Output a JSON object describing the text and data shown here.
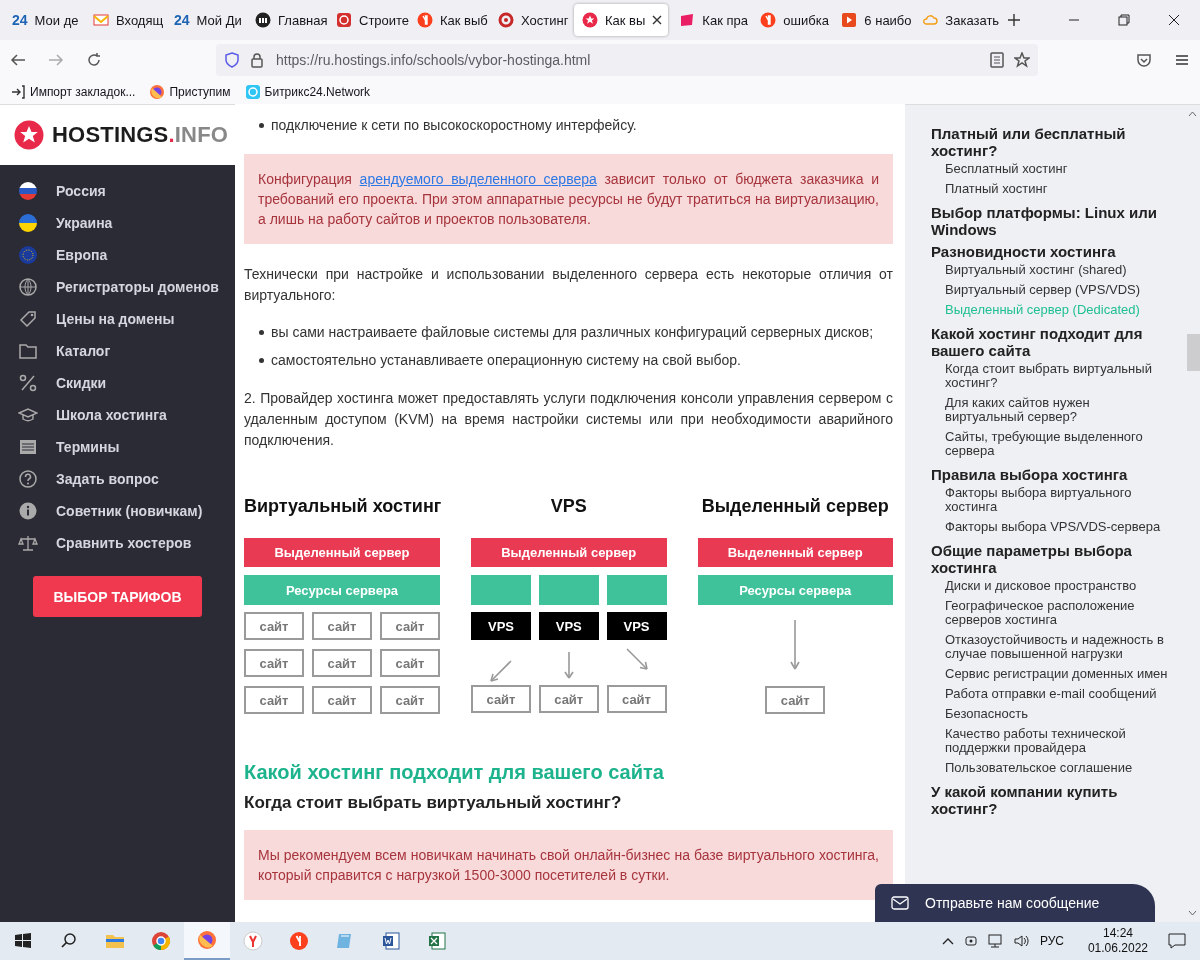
{
  "browser": {
    "tabs": [
      {
        "label": "Мои де",
        "badge": "24",
        "selected": false
      },
      {
        "label": "Входящ",
        "kind": "mail",
        "selected": false
      },
      {
        "label": "Мой Ди",
        "badge": "24",
        "selected": false
      },
      {
        "label": "Главная",
        "kind": "m",
        "selected": false
      },
      {
        "label": "Строите",
        "kind": "seal",
        "selected": false
      },
      {
        "label": "Как выб",
        "kind": "ya",
        "selected": false
      },
      {
        "label": "Хостинг",
        "kind": "ring",
        "selected": false
      },
      {
        "label": "Как вы",
        "kind": "star",
        "selected": true
      },
      {
        "label": "Как пра",
        "kind": "pink",
        "selected": false
      },
      {
        "label": "ошибка",
        "kind": "ya",
        "selected": false
      },
      {
        "label": "6 наибо",
        "kind": "play",
        "selected": false
      },
      {
        "label": "Заказать",
        "kind": "cloud",
        "selected": false
      }
    ],
    "url": "https://ru.hostings.info/schools/vybor-hostinga.html",
    "bookmarks": [
      {
        "label": "Импорт закладок...",
        "kind": "import"
      },
      {
        "label": "Приступим",
        "kind": "firefox"
      },
      {
        "label": "Битрикс24.Network",
        "kind": "bitrix"
      }
    ]
  },
  "sidebar": {
    "logo": {
      "name": "HOSTINGS",
      "suffix": ".INFO"
    },
    "items": [
      {
        "label": "Россия",
        "kind": "flag-ru"
      },
      {
        "label": "Украина",
        "kind": "flag-ua"
      },
      {
        "label": "Европа",
        "kind": "flag-eu"
      },
      {
        "label": "Регистраторы доменов",
        "kind": "globe"
      },
      {
        "label": "Цены на домены",
        "kind": "tag"
      },
      {
        "label": "Каталог",
        "kind": "folder"
      },
      {
        "label": "Скидки",
        "kind": "percent"
      },
      {
        "label": "Школа хостинга",
        "kind": "cap"
      },
      {
        "label": "Термины",
        "kind": "list"
      },
      {
        "label": "Задать вопрос",
        "kind": "question"
      },
      {
        "label": "Советник (новичкам)",
        "kind": "info"
      },
      {
        "label": "Сравнить хостеров",
        "kind": "scales"
      }
    ],
    "button": "ВЫБОР ТАРИФОВ"
  },
  "article": {
    "blocks": [
      {
        "kind": "bullets",
        "items": [
          "подключение к сети по высокоскоростному интерфейсу."
        ]
      },
      {
        "kind": "callout",
        "before": "Конфигурация ",
        "link": "арендуемого выделенного сервера",
        "after": " зависит только от бюджета заказчика и требований его проекта. При этом аппаратные ресурсы не будут тратиться на виртуализацию, а лишь на работу сайтов и проектов пользователя."
      },
      {
        "kind": "paragraph",
        "text": "Технически при настройке и использовании выделенного сервера есть некоторые отличия от виртуального:"
      },
      {
        "kind": "bullets",
        "items": [
          "вы сами настраиваете файловые системы для различных конфигураций серверных дисков;",
          "самостоятельно устанавливаете операционную систему на свой выбор."
        ]
      },
      {
        "kind": "paragraph",
        "text": "2. Провайдер хостинга может предоставлять услуги подключения консоли управления сервером с удаленным доступом (KVM) на время настройки системы или при необходимости аварийного подключения."
      },
      {
        "kind": "diagram",
        "columns": [
          {
            "kind": "shared",
            "title": "Виртуальный хостинг",
            "server": "Выделенный сервер",
            "resources": "Ресурсы сервера",
            "sites": [
              "сайт",
              "сайт",
              "сайт",
              "сайт",
              "сайт",
              "сайт",
              "сайт",
              "сайт",
              "сайт"
            ]
          },
          {
            "kind": "vps",
            "title": "VPS",
            "server": "Выделенный сервер",
            "vps": [
              "VPS",
              "VPS",
              "VPS"
            ],
            "sites": [
              "сайт",
              "сайт",
              "сайт"
            ]
          },
          {
            "kind": "dedicated",
            "title": "Выделенный сервер",
            "server": "Выделенный сервер",
            "resources": "Ресурсы сервера",
            "sites": [
              "сайт"
            ]
          }
        ]
      },
      {
        "kind": "heading",
        "text": "Какой хостинг подходит для вашего сайта"
      },
      {
        "kind": "subheading",
        "text": "Когда стоит выбрать виртуальный хостинг?"
      },
      {
        "kind": "callout",
        "before": "Мы рекомендуем всем новичкам начинать свой онлайн-бизнес на базе виртуального хостинга, который справится с нагрузкой 1500-3000 посетителей в сутки."
      }
    ]
  },
  "toc": [
    {
      "title": "Платный или бесплатный хостинг?",
      "children": [
        {
          "label": "Бесплатный хостинг",
          "selected": false
        },
        {
          "label": "Платный хостинг",
          "selected": false
        }
      ]
    },
    {
      "title": "Выбор платформы: Linux или Windows"
    },
    {
      "title": "Разновидности хостинга",
      "children": [
        {
          "label": "Виртуальный хостинг (shared)",
          "selected": false
        },
        {
          "label": "Виртуальный сервер (VPS/VDS)",
          "selected": false
        },
        {
          "label": "Выделенный сервер (Dedicated)",
          "selected": true
        }
      ]
    },
    {
      "title": "Какой хостинг подходит для вашего сайта",
      "children": [
        {
          "label": "Когда стоит выбрать виртуальный хостинг?",
          "selected": false
        },
        {
          "label": "Для каких сайтов нужен виртуальный сервер?",
          "selected": false
        },
        {
          "label": "Сайты, требующие выделенного сервера",
          "selected": false
        }
      ]
    },
    {
      "title": "Правила выбора хостинга",
      "children": [
        {
          "label": "Факторы выбора виртуального хостинга",
          "selected": false
        },
        {
          "label": "Факторы выбора VPS/VDS-сервера",
          "selected": false
        }
      ]
    },
    {
      "title": "Общие параметры выбора хостинга",
      "children": [
        {
          "label": "Диски и дисковое пространство",
          "selected": false
        },
        {
          "label": "Географическое расположение серверов хостинга",
          "selected": false
        },
        {
          "label": "Отказоустойчивость и надежность в случае повышенной нагрузки",
          "selected": false
        },
        {
          "label": "Сервис регистрации доменных имен",
          "selected": false
        },
        {
          "label": "Работа отправки e-mail сообщений",
          "selected": false
        },
        {
          "label": "Безопасность",
          "selected": false
        },
        {
          "label": "Качество работы технической поддержки провайдера",
          "selected": false
        },
        {
          "label": "Пользовательское соглашение",
          "selected": false
        }
      ]
    },
    {
      "title": "У какой компании купить хостинг?"
    }
  ],
  "chat": {
    "label": "Отправьте нам сообщение"
  },
  "taskbar": {
    "apps": [
      {
        "kind": "windows",
        "selected": false
      },
      {
        "kind": "search",
        "selected": false
      },
      {
        "kind": "explorer",
        "selected": false
      },
      {
        "kind": "chrome",
        "selected": false
      },
      {
        "kind": "firefox",
        "selected": true
      },
      {
        "kind": "yabrowser",
        "selected": false
      },
      {
        "kind": "yandex",
        "selected": false
      },
      {
        "kind": "app",
        "selected": false
      },
      {
        "kind": "word",
        "selected": false
      },
      {
        "kind": "excel",
        "selected": false
      }
    ],
    "language": "РУС",
    "time": "14:24",
    "date": "01.06.2022"
  }
}
